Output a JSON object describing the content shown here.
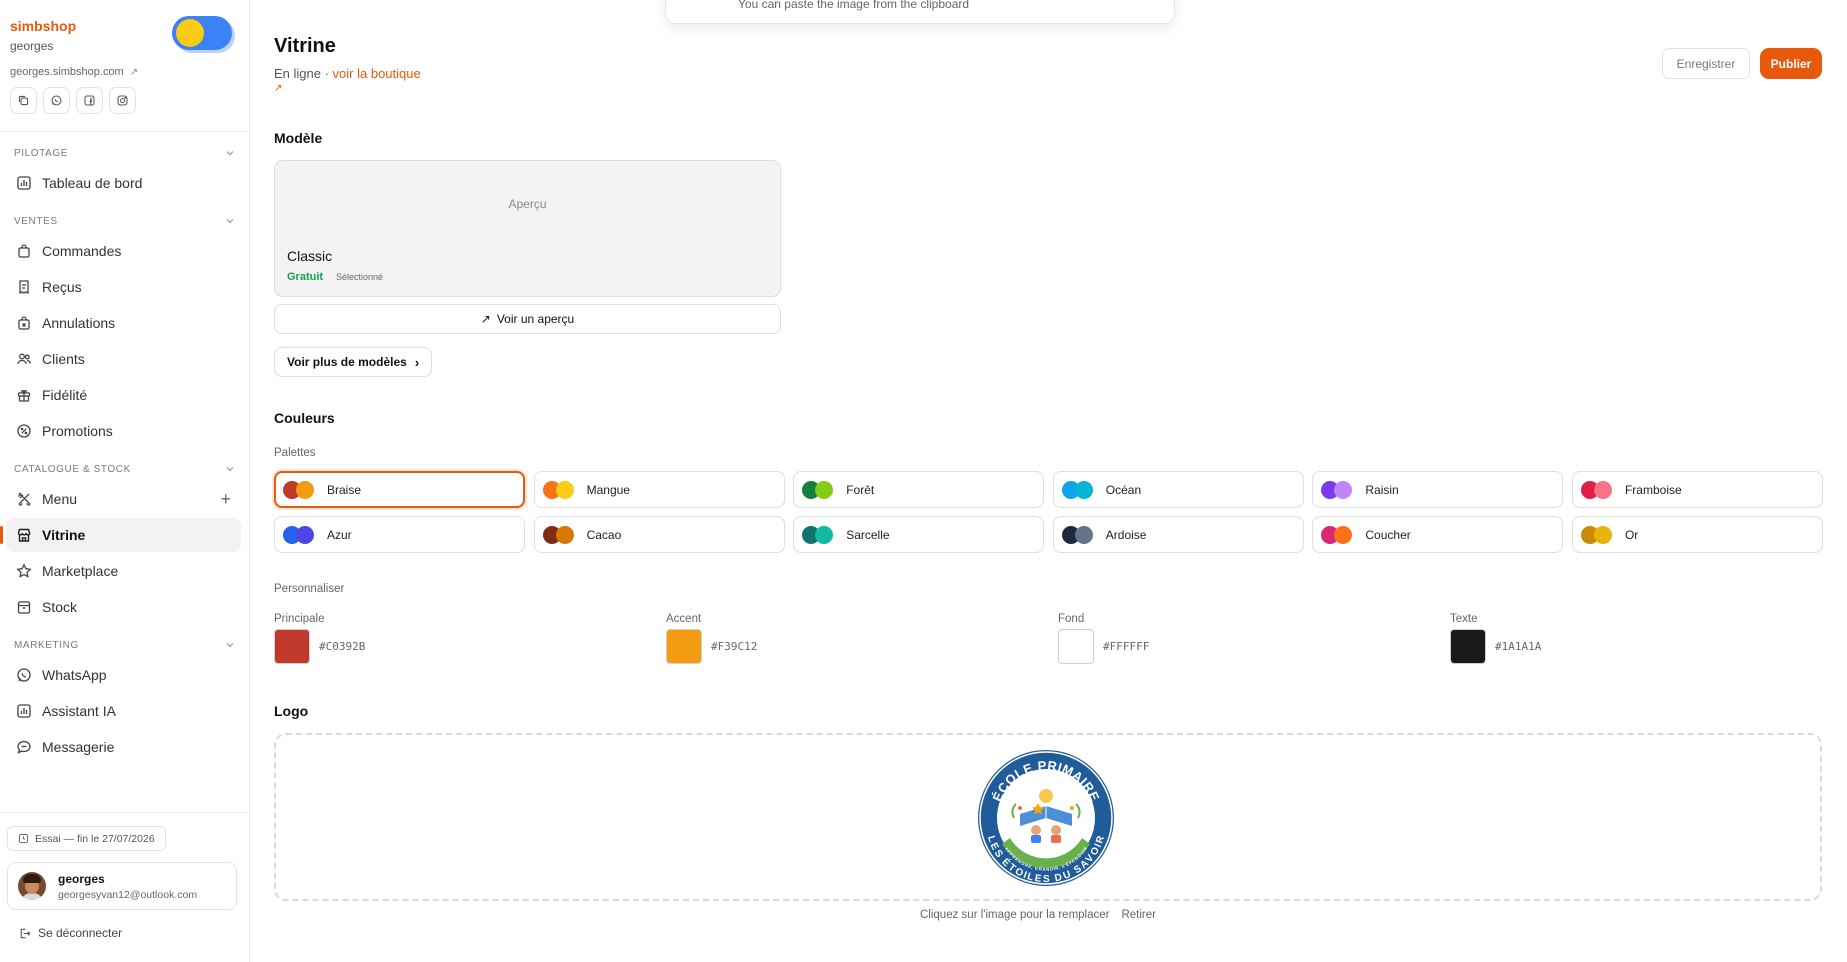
{
  "sidebar": {
    "brand": "simbshop",
    "user_short": "georges",
    "shop_url": "georges.simbshop.com",
    "social_icons": [
      "copy-icon",
      "whatsapp-icon",
      "facebook-icon",
      "instagram-icon"
    ],
    "sections": [
      {
        "label": "Pilotage",
        "items": [
          {
            "label": "Tableau de bord",
            "icon": "chart-icon"
          }
        ]
      },
      {
        "label": "Ventes",
        "items": [
          {
            "label": "Commandes",
            "icon": "bag-icon"
          },
          {
            "label": "Reçus",
            "icon": "receipt-icon"
          },
          {
            "label": "Annulations",
            "icon": "cancel-icon"
          },
          {
            "label": "Clients",
            "icon": "users-icon"
          },
          {
            "label": "Fidélité",
            "icon": "gift-icon"
          },
          {
            "label": "Promotions",
            "icon": "percent-icon"
          }
        ]
      },
      {
        "label": "Catalogue & Stock",
        "items": [
          {
            "label": "Menu",
            "icon": "utensils-icon"
          },
          {
            "label": "Vitrine",
            "icon": "store-icon",
            "active": true
          },
          {
            "label": "Marketplace",
            "icon": "star-icon"
          },
          {
            "label": "Stock",
            "icon": "box-icon"
          }
        ]
      },
      {
        "label": "Marketing",
        "items": [
          {
            "label": "WhatsApp",
            "icon": "whatsapp-icon"
          },
          {
            "label": "Assistant IA",
            "icon": "chart-icon"
          },
          {
            "label": "Messagerie",
            "icon": "chat-icon"
          }
        ]
      }
    ],
    "trial": "Essai — fin le 27/07/2026",
    "user_name": "georges",
    "user_email": "georgesyvan12@outlook.com",
    "logout": "Se déconnecter"
  },
  "toast": {
    "text": "You can paste the image from the clipboard"
  },
  "header": {
    "title": "Vitrine",
    "status": "En ligne ·",
    "shop_link": "voir la boutique",
    "save_label": "Enregistrer",
    "publish_label": "Publier"
  },
  "template": {
    "heading": "Modèle",
    "preview_placeholder": "Aperçu",
    "name": "Classic",
    "price": "Gratuit",
    "state": "Sélectionné",
    "preview_button": "Voir un aperçu",
    "more_button": "Voir plus de modèles"
  },
  "colors": {
    "heading": "Couleurs",
    "palettes_label": "Palettes",
    "palettes": [
      {
        "name": "Braise",
        "c1": "#C0392B",
        "c2": "#F39C12",
        "selected": true
      },
      {
        "name": "Mangue",
        "c1": "#F97316",
        "c2": "#FACC15"
      },
      {
        "name": "Forêt",
        "c1": "#15803D",
        "c2": "#84CC16"
      },
      {
        "name": "Océan",
        "c1": "#0EA5E9",
        "c2": "#06B6D4"
      },
      {
        "name": "Raisin",
        "c1": "#7C3AED",
        "c2": "#C084FC"
      },
      {
        "name": "Framboise",
        "c1": "#E11D48",
        "c2": "#FB7185"
      },
      {
        "name": "Azur",
        "c1": "#2563EB",
        "c2": "#4F46E5"
      },
      {
        "name": "Cacao",
        "c1": "#7C2D12",
        "c2": "#D97706"
      },
      {
        "name": "Sarcelle",
        "c1": "#0F766E",
        "c2": "#14B8A6"
      },
      {
        "name": "Ardoise",
        "c1": "#1E293B",
        "c2": "#64748B"
      },
      {
        "name": "Coucher",
        "c1": "#DB2777",
        "c2": "#F97316"
      },
      {
        "name": "Or",
        "c1": "#CA8A04",
        "c2": "#EAB308"
      }
    ],
    "customize_label": "Personnaliser",
    "custom": [
      {
        "label": "Principale",
        "hex": "#C0392B"
      },
      {
        "label": "Accent",
        "hex": "#F39C12"
      },
      {
        "label": "Fond",
        "hex": "#FFFFFF"
      },
      {
        "label": "Texte",
        "hex": "#1A1A1A"
      }
    ]
  },
  "logo": {
    "heading": "Logo",
    "badge_text_top": "ÉCOLE PRIMAIRE",
    "badge_text_bottom": "LES ÉTOILES DU SAVOIR",
    "badge_motto": "APPRENDRE, GRANDIR, S'ÉPANOUIR",
    "replace_hint": "Cliquez sur l'image pour la remplacer",
    "remove_label": "Retirer"
  },
  "theme": {
    "accent": "#E8590C",
    "success": "#16A34A"
  }
}
